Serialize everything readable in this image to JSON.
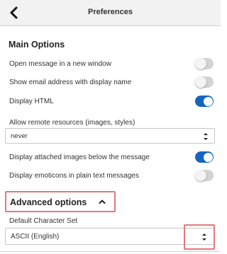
{
  "header": {
    "title": "Preferences",
    "back_icon": "chevron-left-icon"
  },
  "main_options": {
    "title": "Main Options",
    "items": [
      {
        "label": "Open message in a new window",
        "state": "off"
      },
      {
        "label": "Show email address with display name",
        "state": "off"
      },
      {
        "label": "Display HTML",
        "state": "on"
      }
    ],
    "remote_resources": {
      "label": "Allow remote resources (images, styles)",
      "value": "never"
    },
    "items2": [
      {
        "label": "Display attached images below the message",
        "state": "on"
      },
      {
        "label": "Display emoticons in plain text messages",
        "state": "off"
      }
    ]
  },
  "advanced": {
    "title": "Advanced options",
    "icon": "chevron-up-icon",
    "charset": {
      "label": "Default Character Set",
      "value": "ASCII (English)"
    }
  },
  "colors": {
    "toggle_on": "#1565c0",
    "toggle_off": "#d4d4d4",
    "highlight": "#e07a7a"
  }
}
